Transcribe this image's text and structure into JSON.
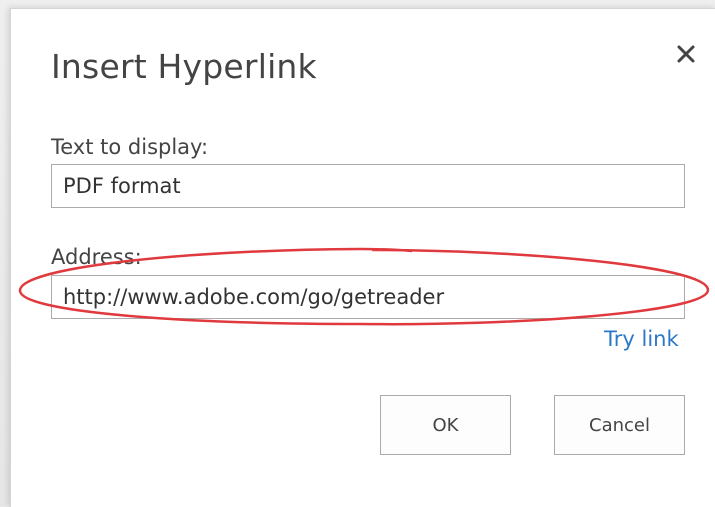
{
  "dialog": {
    "title": "Insert Hyperlink",
    "close_icon": "close-icon",
    "text_to_display": {
      "label": "Text to display:",
      "value": "PDF format"
    },
    "address": {
      "label": "Address:",
      "value": "http://www.adobe.com/go/getreader"
    },
    "try_link_label": "Try link",
    "ok_label": "OK",
    "cancel_label": "Cancel"
  },
  "colors": {
    "link": "#2c78c8",
    "highlight_ring": "#e0393e",
    "border": "#ababab"
  }
}
